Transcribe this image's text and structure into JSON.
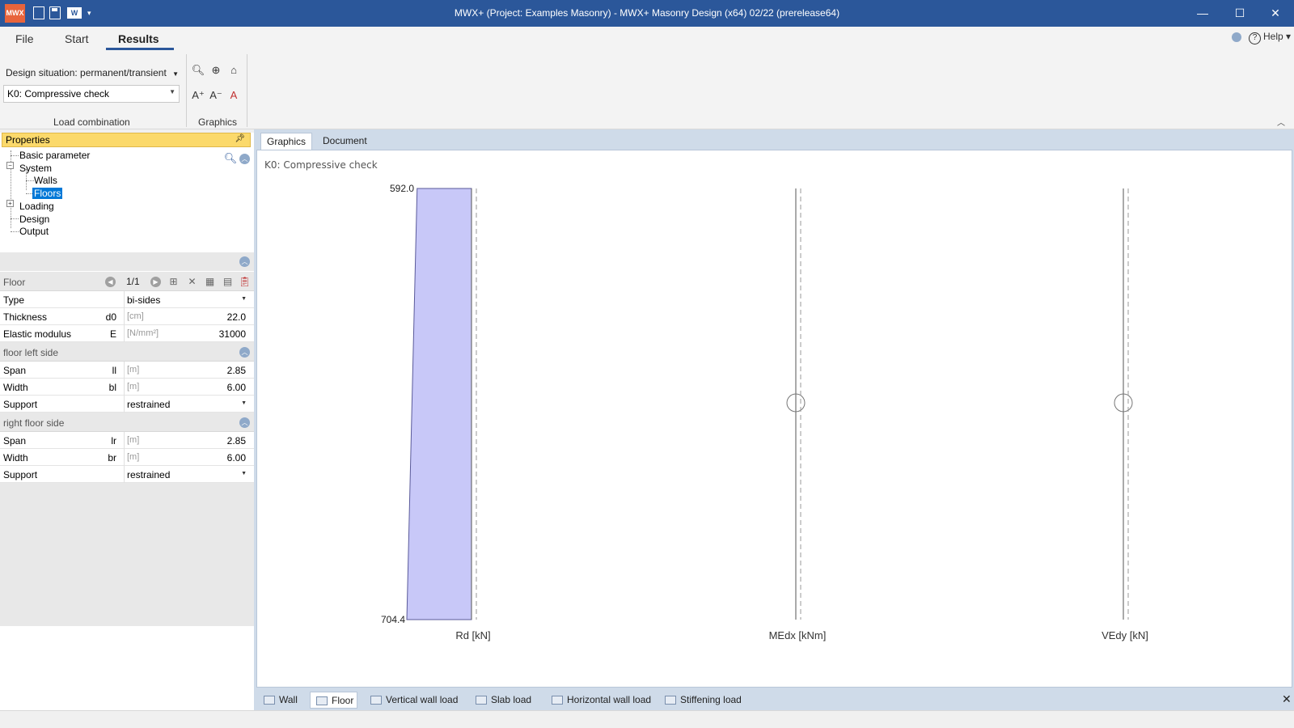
{
  "window": {
    "logo": "MWX",
    "title": "MWX+ (Project: Examples Masonry) - MWX+ Masonry Design (x64) 02/22 (prerelease64)",
    "minimize": "—",
    "maximize": "☐",
    "close": "✕"
  },
  "ribbon_tabs": {
    "file": "File",
    "start": "Start",
    "results": "Results",
    "help": "Help"
  },
  "ribbon": {
    "design_situation": "Design situation: permanent/transient",
    "load_combination_value": "K0: Compressive check",
    "group_load_combination": "Load combination",
    "group_graphics": "Graphics"
  },
  "properties": {
    "header": "Properties",
    "tree": {
      "basic_parameter": "Basic parameter",
      "system": "System",
      "walls": "Walls",
      "floors": "Floors",
      "loading": "Loading",
      "design": "Design",
      "output": "Output"
    },
    "floor": {
      "label": "Floor",
      "page": "1/1"
    },
    "rows": {
      "type": {
        "name": "Type",
        "value": "bi-sides"
      },
      "thickness": {
        "name": "Thickness",
        "symbol": "d0",
        "unit": "[cm]",
        "value": "22.0"
      },
      "elastic": {
        "name": "Elastic modulus",
        "symbol": "E",
        "unit": "[N/mm²]",
        "value": "31000"
      }
    },
    "left_side": {
      "header": "floor left side",
      "span": {
        "name": "Span",
        "symbol": "ll",
        "unit": "[m]",
        "value": "2.85"
      },
      "width": {
        "name": "Width",
        "symbol": "bl",
        "unit": "[m]",
        "value": "6.00"
      },
      "support": {
        "name": "Support",
        "value": "restrained"
      }
    },
    "right_side": {
      "header": "right floor side",
      "span": {
        "name": "Span",
        "symbol": "lr",
        "unit": "[m]",
        "value": "2.85"
      },
      "width": {
        "name": "Width",
        "symbol": "br",
        "unit": "[m]",
        "value": "6.00"
      },
      "support": {
        "name": "Support",
        "value": "restrained"
      }
    }
  },
  "doc_tabs": {
    "graphics": "Graphics",
    "document": "Document"
  },
  "chart_data": {
    "type": "area",
    "title": "K0: Compressive check",
    "diagrams": [
      {
        "label": "Rd [kN]",
        "top_value": 592.0,
        "bottom_value": 704.4,
        "top_label": "592.0",
        "bottom_label": "704.4"
      },
      {
        "label": "MEdx [kNm]",
        "values": []
      },
      {
        "label": "VEdy [kN]",
        "values": []
      }
    ],
    "fill_color": "#c8c8f8",
    "stroke_color": "#5a5a9a"
  },
  "bottom_tabs": [
    "Wall",
    "Floor",
    "Vertical wall load",
    "Slab load",
    "Horizontal wall load",
    "Stiffening load"
  ],
  "bottom_active": "Floor",
  "colors": {
    "titlebar": "#2b579a",
    "accent": "#2b579a",
    "properties_header": "#fbd96b",
    "selection": "#0078d7"
  }
}
